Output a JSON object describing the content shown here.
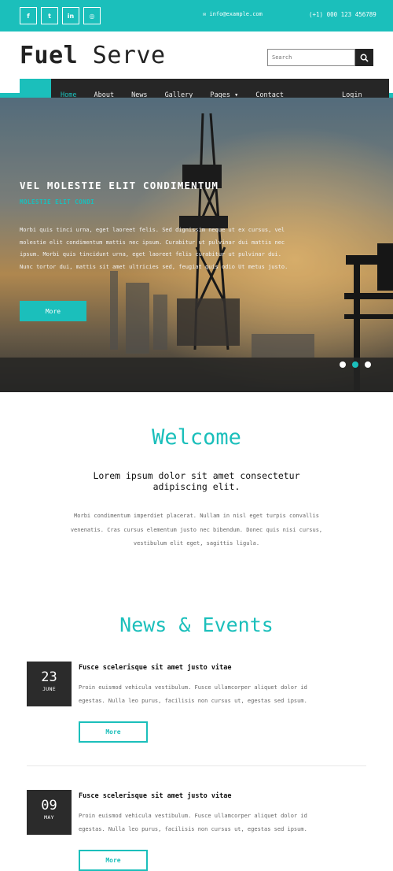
{
  "topbar": {
    "social": [
      {
        "icon": "facebook-icon",
        "glyph": "f"
      },
      {
        "icon": "twitter-icon",
        "glyph": "t"
      },
      {
        "icon": "linkedin-icon",
        "glyph": "in"
      },
      {
        "icon": "dribbble-icon",
        "glyph": "◎"
      }
    ],
    "email": "✉ info@example.com",
    "phone": "(+1) 000 123 456789"
  },
  "header": {
    "logo_bold": "Fuel",
    "logo_light": " Serve",
    "search_placeholder": "Search"
  },
  "nav": {
    "items": [
      "Home",
      "About",
      "News",
      "Gallery",
      "Pages ▾",
      "Contact"
    ],
    "active_index": 0,
    "login": "Login"
  },
  "hero": {
    "title": "VEL MOLESTIE ELIT CONDIMENTUM",
    "subtitle": "MOLESTIE ELIT CONDI",
    "text": "Morbi quis tinci urna, eget laoreet felis. Sed dignissim neque ut ex cursus, vel molestie elit condimentum mattis nec ipsum. Curabitur ut pulvinar dui mattis nec ipsum. Morbi quis tincidunt urna, eget laoreet felis curabitur ut pulvinar dui. Nunc tortor dui, mattis sit amet ultricies sed, feugiat quis odio Ut metus justo.",
    "button": "More",
    "slides": 3,
    "active_slide": 1
  },
  "welcome": {
    "title": "Welcome",
    "lead": "Lorem ipsum dolor sit amet consectetur adipiscing elit.",
    "body": "Morbi condimentum imperdiet placerat. Nullam in nisl eget turpis convallis venenatis. Cras cursus elementum justo nec bibendum. Donec quis nisi cursus, vestibulum elit eget, sagittis ligula."
  },
  "news": {
    "title": "News & Events",
    "items": [
      {
        "day": "23",
        "month": "JUNE",
        "heading": "Fusce scelerisque sit amet justo vitae",
        "body": "Proin euismod vehicula vestibulum. Fusce ullamcorper aliquet dolor id egestas. Nulla leo purus, facilisis non cursus ut, egestas sed ipsum.",
        "button": "More"
      },
      {
        "day": "09",
        "month": "MAY",
        "heading": "Fusce scelerisque sit amet justo vitae",
        "body": "Proin euismod vehicula vestibulum. Fusce ullamcorper aliquet dolor id egestas. Nulla leo purus, facilisis non cursus ut, egestas sed ipsum.",
        "button": "More"
      }
    ]
  },
  "colors": {
    "accent": "#1bbfbb",
    "dark": "#262626"
  }
}
